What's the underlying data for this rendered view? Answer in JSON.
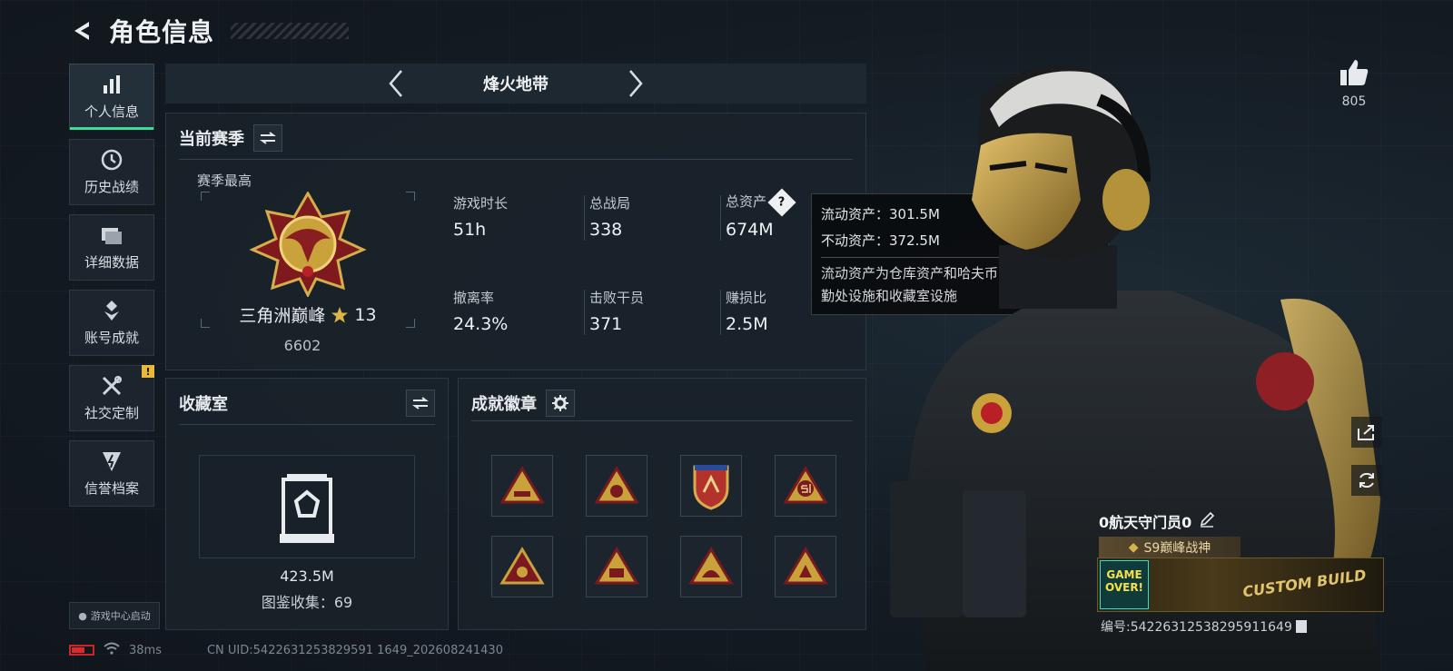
{
  "header": {
    "title": "角色信息"
  },
  "sidebar": {
    "items": [
      {
        "label": "个人信息",
        "icon": "bar-chart-icon",
        "active": true
      },
      {
        "label": "历史战绩",
        "icon": "clock-icon"
      },
      {
        "label": "详细数据",
        "icon": "folder-icon"
      },
      {
        "label": "账号成就",
        "icon": "medal-icon"
      },
      {
        "label": "社交定制",
        "icon": "tools-icon",
        "badge": "!"
      },
      {
        "label": "信誉档案",
        "icon": "shield-bolt-icon"
      }
    ],
    "game_center": "游戏中心启动"
  },
  "status": {
    "ping": "38ms",
    "uid": "CN UID:5422631253829591 1649_202608241430"
  },
  "mode": {
    "title": "烽火地带"
  },
  "season": {
    "title": "当前赛季",
    "best_label": "赛季最高",
    "rank_name": "三角洲巅峰",
    "rank_stars": "13",
    "rank_score": "6602",
    "stats": [
      {
        "label": "游戏时长",
        "value": "51h"
      },
      {
        "label": "总战局",
        "value": "338"
      },
      {
        "label": "总资产",
        "value": "674M"
      },
      {
        "label": "撤离率",
        "value": "24.3%"
      },
      {
        "label": "击败干员",
        "value": "371"
      },
      {
        "label": "赚损比",
        "value": "2.5M"
      }
    ]
  },
  "tooltip": {
    "liquid": "流动资产：301.5M",
    "fixed": "不动资产：372.5M",
    "note": "流动资产为仓库资产和哈夫币，不动资产为特勤处设施和收藏室设施"
  },
  "collection": {
    "title": "收藏室",
    "value": "423.5M",
    "count": "图鉴收集：69"
  },
  "badges": {
    "title": "成就徽章"
  },
  "profile": {
    "likes": "805",
    "name": "0航天守门员0",
    "title_tag": "S9巅峰战神",
    "banner_go": "GAME OVER!",
    "banner_tag": "CUSTOM BUILD",
    "serial": "编号:54226312538295911649"
  },
  "colors": {
    "accent": "#3ddc97",
    "gold": "#c9a23c",
    "warn": "#e8b93a"
  }
}
